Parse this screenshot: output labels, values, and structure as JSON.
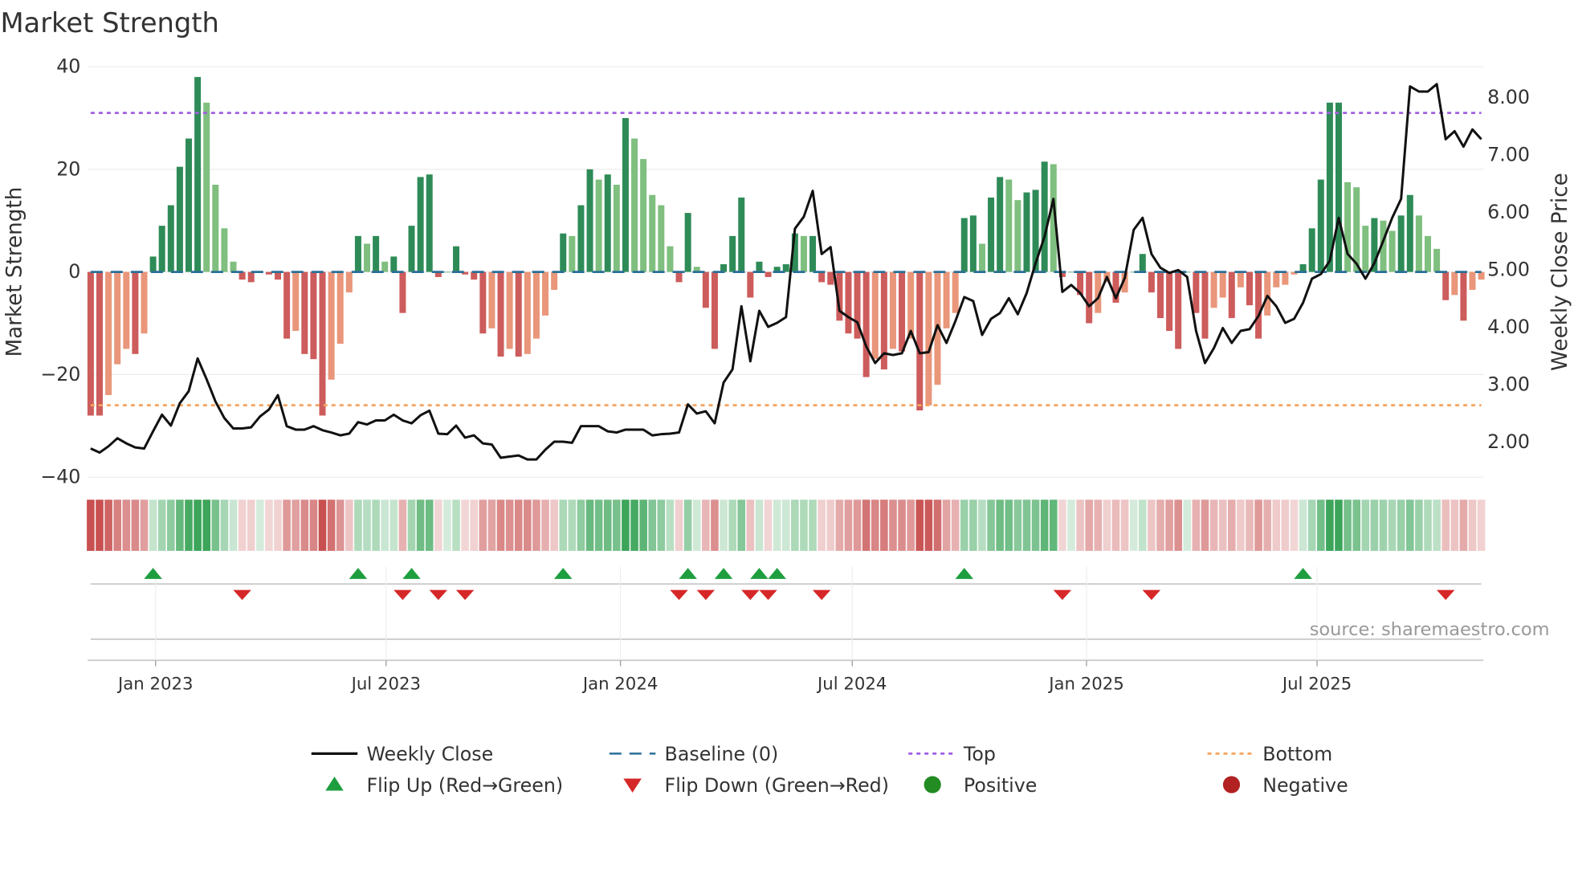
{
  "chart_data": {
    "type": "bar",
    "title": "Market Strength",
    "ylabel": "Market Strength",
    "y2label": "Weekly Close Price",
    "ylim": [
      -40,
      40
    ],
    "y2lim": [
      1.0,
      8.5
    ],
    "yticks": [
      "40",
      "20",
      "0",
      "−20",
      "−40"
    ],
    "ytick_values": [
      40,
      20,
      0,
      -20,
      -40
    ],
    "y2ticks": [
      "8.00",
      "7.00",
      "6.00",
      "5.00",
      "4.00",
      "3.00",
      "2.00"
    ],
    "y2tick_values": [
      8,
      7,
      6,
      5,
      4,
      3,
      2
    ],
    "xticks": [
      {
        "label": "Jan 2023",
        "date": "2023-01-01"
      },
      {
        "label": "Jul 2023",
        "date": "2023-07-01"
      },
      {
        "label": "Jan 2024",
        "date": "2024-01-01"
      },
      {
        "label": "Jul 2024",
        "date": "2024-07-01"
      },
      {
        "label": "Jan 2025",
        "date": "2025-01-01"
      },
      {
        "label": "Jul 2025",
        "date": "2025-07-01"
      }
    ],
    "start_week": "2022-11-11",
    "frequency": "weekly",
    "top_level": 31,
    "bottom_level": -26,
    "baseline": 0,
    "strength": [
      -28,
      -28,
      -24,
      -18,
      -15,
      -16,
      -12,
      3,
      9,
      13,
      20.5,
      26,
      38,
      33,
      17,
      8.5,
      2,
      -1.5,
      -2,
      0,
      -0.5,
      -1.5,
      -13,
      -11.5,
      -16,
      -17,
      -28,
      -21,
      -14,
      -4,
      7,
      5.5,
      7,
      2,
      3,
      -8,
      9,
      18.5,
      19,
      -1,
      0,
      5,
      -0.5,
      -1.5,
      -12,
      -11,
      -16.5,
      -15,
      -16.5,
      -16,
      -13,
      -8.5,
      -3.5,
      7.5,
      7,
      13,
      20,
      18,
      19,
      17,
      30,
      26,
      22,
      15,
      13,
      5,
      -2,
      11.5,
      1,
      -7,
      -15,
      1.5,
      7,
      14.5,
      -5,
      2,
      -1,
      1,
      1.5,
      7.5,
      7,
      7,
      -2,
      -2.5,
      -9.5,
      -12,
      -13,
      -20.5,
      -17,
      -19,
      -15,
      -15.5,
      -13,
      -27,
      -26,
      -22,
      -11,
      -8,
      10.5,
      11,
      5.5,
      14.5,
      18.5,
      18,
      14,
      15.5,
      16,
      21.5,
      21,
      -1,
      0,
      -4.5,
      -10,
      -8,
      -2,
      -6,
      -4,
      0,
      3.5,
      -4,
      -9,
      -11.5,
      -15,
      0,
      -8,
      -13,
      -7,
      -5,
      -9,
      -3,
      -6.5,
      -13,
      -8.5,
      -3,
      -2.5,
      -0.5,
      1.5,
      8.5,
      18,
      33,
      33,
      17.5,
      16.5,
      9,
      10.5,
      10,
      8,
      11,
      15,
      11,
      7,
      4.5,
      -5.5,
      -4.5,
      -9.5,
      -3.5,
      -1.5
    ],
    "weekly_close": [
      1.87,
      1.8,
      1.91,
      2.05,
      1.96,
      1.89,
      1.87,
      2.17,
      2.46,
      2.27,
      2.66,
      2.87,
      3.44,
      3.08,
      2.69,
      2.4,
      2.22,
      2.22,
      2.24,
      2.43,
      2.55,
      2.8,
      2.26,
      2.2,
      2.2,
      2.26,
      2.19,
      2.15,
      2.1,
      2.13,
      2.33,
      2.29,
      2.36,
      2.36,
      2.46,
      2.36,
      2.31,
      2.45,
      2.53,
      2.13,
      2.12,
      2.27,
      2.06,
      2.1,
      1.96,
      1.94,
      1.71,
      1.73,
      1.75,
      1.68,
      1.68,
      1.85,
      1.99,
      1.99,
      1.97,
      2.26,
      2.26,
      2.26,
      2.17,
      2.15,
      2.2,
      2.2,
      2.2,
      2.1,
      2.12,
      2.13,
      2.15,
      2.64,
      2.48,
      2.52,
      2.31,
      3.02,
      3.25,
      4.35,
      3.39,
      4.27,
      3.99,
      4.06,
      4.16,
      5.7,
      5.91,
      6.36,
      5.26,
      5.38,
      4.27,
      4.16,
      4.07,
      3.65,
      3.36,
      3.53,
      3.5,
      3.53,
      3.92,
      3.53,
      3.55,
      4.02,
      3.71,
      4.09,
      4.51,
      4.44,
      3.85,
      4.13,
      4.23,
      4.49,
      4.21,
      4.58,
      5.1,
      5.56,
      6.22,
      4.6,
      4.72,
      4.58,
      4.35,
      4.49,
      4.86,
      4.49,
      4.84,
      5.68,
      5.89,
      5.26,
      5.02,
      4.93,
      4.98,
      4.86,
      3.92,
      3.36,
      3.62,
      3.97,
      3.71,
      3.92,
      3.95,
      4.18,
      4.53,
      4.35,
      4.06,
      4.13,
      4.41,
      4.83,
      4.91,
      5.14,
      5.89,
      5.26,
      5.09,
      4.83,
      5.1,
      5.49,
      5.89,
      6.22,
      8.18,
      8.09,
      8.09,
      8.22,
      7.26,
      7.4,
      7.13,
      7.43,
      7.26
    ],
    "legend": [
      {
        "label": "Weekly Close",
        "kind": "line"
      },
      {
        "label": "Baseline (0)",
        "kind": "dashed"
      },
      {
        "label": "Top",
        "kind": "dotted-top"
      },
      {
        "label": "Bottom",
        "kind": "dotted-bottom"
      },
      {
        "label": "Flip Up (Red→Green)",
        "kind": "tri-up"
      },
      {
        "label": "Flip Down (Green→Red)",
        "kind": "tri-down"
      },
      {
        "label": "Positive",
        "kind": "dot-pos"
      },
      {
        "label": "Negative",
        "kind": "dot-neg"
      }
    ],
    "legend_position": "bottom-center",
    "annotation": "source: sharemaestro.com",
    "colors": {
      "pos_rising": "#2e8b57",
      "pos_falling": "#7fbf7f",
      "neg_falling": "#cd5c5c",
      "neg_rising": "#e9967a",
      "close": "#111111",
      "baseline": "#2a6f97",
      "top": "#a35fe0",
      "bottom": "#f4a460",
      "flip_up": "#1e9e3e",
      "flip_down": "#d62728",
      "positive": "#228b22",
      "negative": "#b22222",
      "grid": "#ececec"
    }
  }
}
